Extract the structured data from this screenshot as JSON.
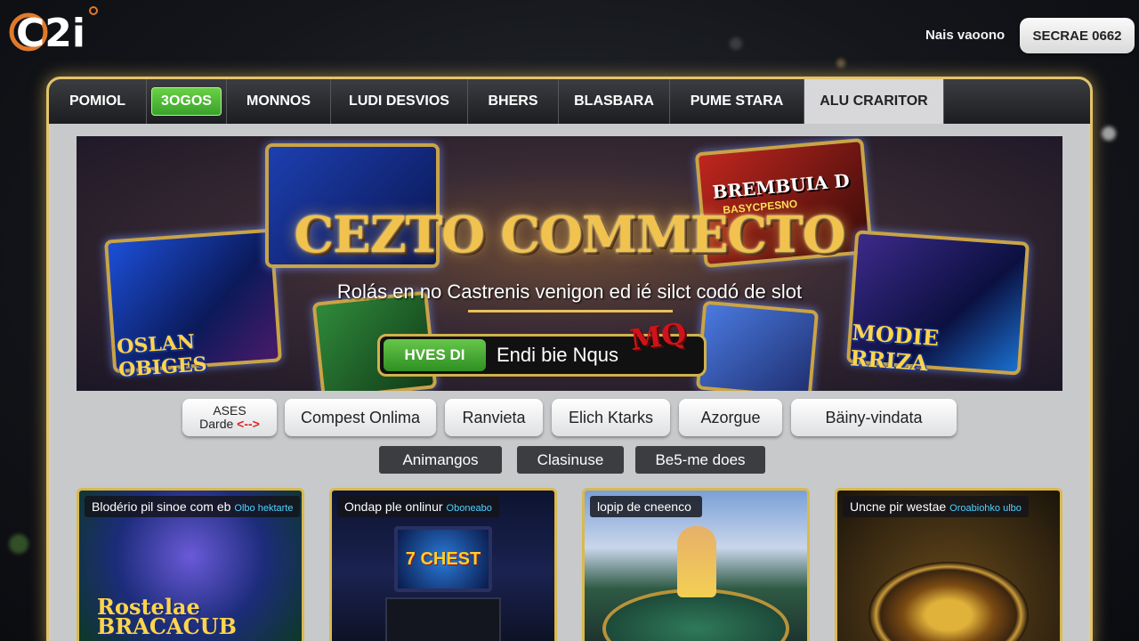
{
  "header": {
    "logo_text": "C2i",
    "user_name": "Nais vaoono",
    "code_button": "SECRAE 0662"
  },
  "nav": {
    "items": [
      {
        "label": "POMIOL"
      },
      {
        "label": "3OGOS",
        "highlight": "#4cb534"
      },
      {
        "label": "MONNOS"
      },
      {
        "label": "LUDI DESVIOS"
      },
      {
        "label": "BHERS"
      },
      {
        "label": "BLASBARA"
      },
      {
        "label": "PUME STARA"
      },
      {
        "label": "ALU CRARITOR",
        "active": true
      }
    ]
  },
  "banner": {
    "title": "CEZTO COMMECTO",
    "subtitle": "Rolás en no Castrenis venigon ed ié silct codó de slot",
    "cta_button": "HVES DI",
    "cta_text": "Endi bie Nqus",
    "cta_logo": "MQ",
    "cards": [
      {
        "label": "OSLAN OBIGES"
      },
      {
        "label": "BREMBUIA D"
      },
      {
        "label": "BASYCPESNO"
      },
      {
        "label": "MODIE RRIZA"
      }
    ]
  },
  "categories": {
    "first_top": "ASES",
    "first_bottom": "Darde",
    "first_arrows": "<-->",
    "items": [
      "Compest Onlima",
      "Ranvieta",
      "Elich Ktarks",
      "Azorgue",
      "Bäiny-vindata"
    ]
  },
  "subcategories": [
    "Animangos",
    "Clasinuse",
    "Be5-me does"
  ],
  "games": [
    {
      "caption": "Blodério pil sinoe com eb",
      "tag": "Olbo hektarte",
      "art": "Rostelae BRACACUB"
    },
    {
      "caption": "Ondap ple onlinur",
      "tag": "Oboneabo",
      "art": "7 CHEST"
    },
    {
      "caption": "lopip de cneenco",
      "tag": "",
      "art": ""
    },
    {
      "caption": "Uncne pir westae",
      "tag": "Oroabiohko ulbo",
      "art": ""
    }
  ],
  "colors": {
    "accent_gold": "#e3c46b",
    "nav_green": "#4cb534",
    "nav_bg": "#2a2b2f",
    "frame_bg": "#c8c9cb"
  }
}
